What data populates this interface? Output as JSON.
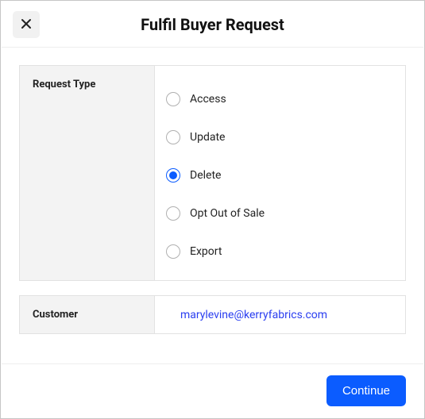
{
  "header": {
    "title": "Fulfil Buyer Request"
  },
  "request_type": {
    "label": "Request Type",
    "options": [
      {
        "label": "Access",
        "selected": false
      },
      {
        "label": "Update",
        "selected": false
      },
      {
        "label": "Delete",
        "selected": true
      },
      {
        "label": "Opt Out of Sale",
        "selected": false
      },
      {
        "label": "Export",
        "selected": false
      }
    ]
  },
  "customer": {
    "label": "Customer",
    "value": "marylevine@kerryfabrics.com"
  },
  "footer": {
    "continue_label": "Continue"
  }
}
